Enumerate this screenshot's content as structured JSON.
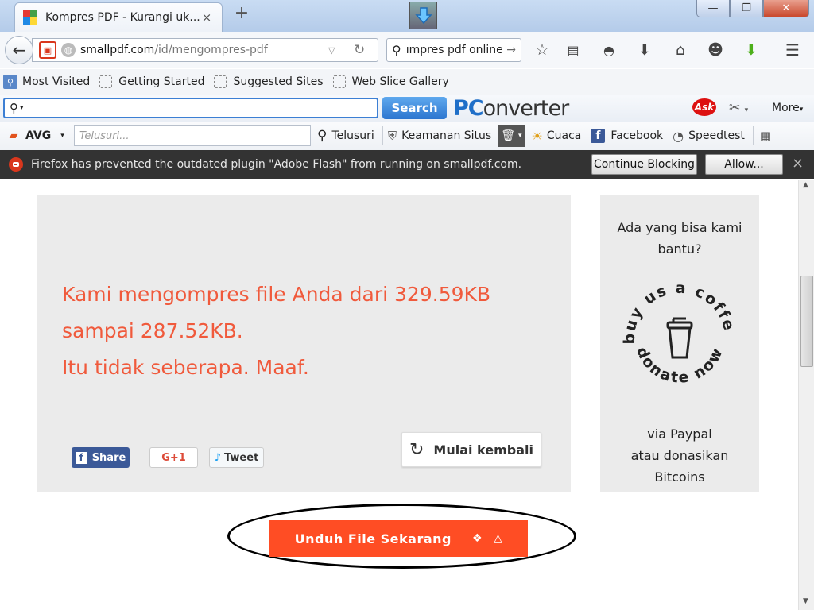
{
  "tab": {
    "title": "Kompres PDF - Kurangi uk...",
    "close_glyph": "×"
  },
  "new_tab_glyph": "+",
  "window": {
    "minimize": "—",
    "maximize": "❐",
    "close": "✕"
  },
  "nav": {
    "url_host": "smallpdf.com",
    "url_path": "/id/mengompres-pdf",
    "search_value": "ımpres pdf online"
  },
  "bookmarks": [
    {
      "label": "Most Visited"
    },
    {
      "label": "Getting Started"
    },
    {
      "label": "Suggested Sites"
    },
    {
      "label": "Web Slice Gallery"
    }
  ],
  "pcconverter": {
    "search_button": "Search",
    "logo_pc": "PC",
    "logo_rest": "onverter",
    "ask": "Ask",
    "more": "More"
  },
  "avg": {
    "logo": "AVG",
    "search_placeholder": "Telusuri...",
    "search_button": "Telusuri",
    "site_safety": "Keamanan Situs",
    "weather": "Cuaca",
    "facebook": "Facebook",
    "speedtest": "Speedtest"
  },
  "notification": {
    "message": "Firefox has prevented the outdated plugin \"Adobe Flash\" from running on smallpdf.com.",
    "continue_blocking": "Continue Blocking",
    "allow": "Allow...",
    "close": "×"
  },
  "result": {
    "line1": "Kami mengompres file Anda dari 329.59KB",
    "line2": "sampai 287.52KB.",
    "line3": "Itu tidak seberapa. Maaf.",
    "share": "Share",
    "gplus": "G+1",
    "tweet": "Tweet",
    "restart": "Mulai kembali"
  },
  "sidebar": {
    "help_line1": "Ada yang bisa kami",
    "help_line2": "bantu?",
    "coffee_top": "buy us a coffee",
    "coffee_bottom": "donate now",
    "via_line1": "via Paypal",
    "via_line2": "atau donasikan",
    "via_line3": "Bitcoins"
  },
  "download": {
    "label": "Unduh File Sekarang"
  },
  "colors": {
    "accent": "#ff4d24",
    "message": "#f05a3c",
    "card": "#ebebeb",
    "notif_bg": "#333333"
  }
}
